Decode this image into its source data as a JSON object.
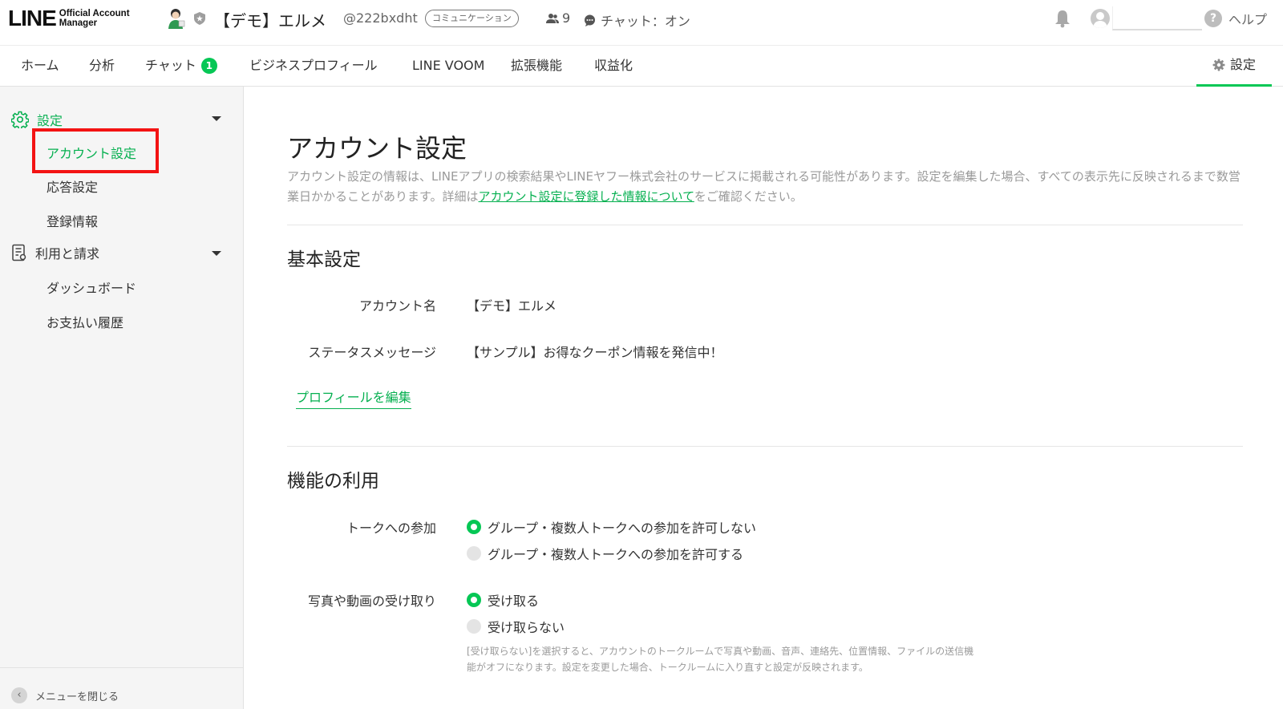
{
  "header": {
    "logo_main": "LINE",
    "logo_sub_line1": "Official Account",
    "logo_sub_line2": "Manager",
    "account_name": "【デモ】エルメ",
    "account_id": "@222bxdht",
    "plan_badge": "コミュニケーション",
    "friend_count": "9",
    "chat_status": "チャット：オン",
    "help_label": "ヘルプ"
  },
  "tabs": {
    "home": "ホーム",
    "analytics": "分析",
    "chat": "チャット",
    "chat_badge": "1",
    "business_profile": "ビジネスプロフィール",
    "voom": "LINE VOOM",
    "extensions": "拡張機能",
    "monetization": "収益化",
    "settings": "設定"
  },
  "sidebar": {
    "settings_group": "設定",
    "account_settings": "アカウント設定",
    "response_settings": "応答設定",
    "registration_info": "登録情報",
    "billing_group": "利用と請求",
    "dashboard": "ダッシュボード",
    "payment_history": "お支払い履歴",
    "close_menu": "メニューを閉じる"
  },
  "main": {
    "title": "アカウント設定",
    "desc_part1": "アカウント設定の情報は、LINEアプリの検索結果やLINEヤフー株式会社のサービスに掲載される可能性があります。設定を編集した場合、すべての表示先に反映されるまで数営業日かかることがあります。詳細は",
    "desc_link": "アカウント設定に登録した情報について",
    "desc_part2": "をご確認ください。",
    "basic_section": "基本設定",
    "account_name_label": "アカウント名",
    "account_name_value": "【デモ】エルメ",
    "status_label": "ステータスメッセージ",
    "status_value": "【サンプル】お得なクーポン情報を発信中！",
    "edit_profile": "プロフィールを編集",
    "features_section": "機能の利用",
    "talk_label": "トークへの参加",
    "talk_option_deny": "グループ・複数人トークへの参加を許可しない",
    "talk_option_allow": "グループ・複数人トークへの参加を許可する",
    "media_label": "写真や動画の受け取り",
    "media_option_receive": "受け取る",
    "media_option_reject": "受け取らない",
    "media_note": "[受け取らない]を選択すると、アカウントのトークルームで写真や動画、音声、連絡先、位置情報、ファイルの送信機能がオフになります。設定を変更した場合、トークルームに入り直すと設定が反映されます。"
  },
  "colors": {
    "brand_green": "#06c755",
    "highlight_red": "#f31313"
  }
}
